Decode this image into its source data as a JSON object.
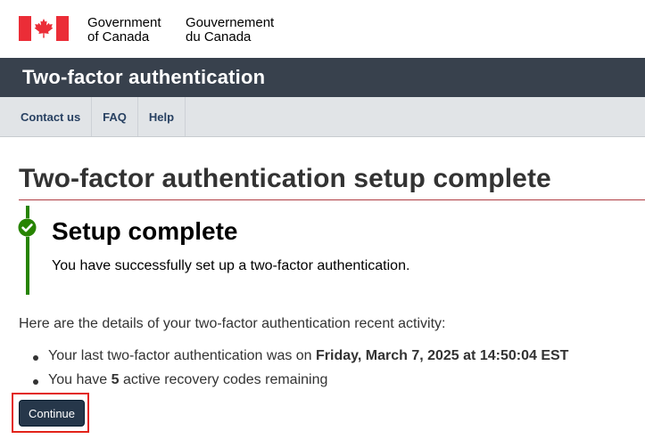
{
  "header": {
    "signature_en_line1": "Government",
    "signature_en_line2": "of Canada",
    "signature_fr_line1": "Gouvernement",
    "signature_fr_line2": "du Canada",
    "flag_color": "#eb2d37"
  },
  "app_banner": {
    "title": "Two-factor authentication",
    "background": "#38414d"
  },
  "menu": {
    "items": [
      {
        "label": "Contact us"
      },
      {
        "label": "FAQ"
      },
      {
        "label": "Help"
      }
    ]
  },
  "page": {
    "title": "Two-factor authentication setup complete"
  },
  "alert": {
    "type": "success",
    "icon": "check-circle-icon",
    "color": "#278400",
    "heading": "Setup complete",
    "body": "You have successfully set up a two-factor authentication."
  },
  "details": {
    "intro": "Here are the details of your two-factor authentication recent activity:",
    "last_auth_prefix": "Your last two-factor authentication was on ",
    "last_auth_value": "Friday, March 7, 2025 at 14:50:04 EST",
    "codes_prefix": "You have ",
    "codes_count": "5",
    "codes_suffix": " active recovery codes remaining"
  },
  "actions": {
    "continue_label": "Continue",
    "highlight_color": "#e2231a"
  }
}
